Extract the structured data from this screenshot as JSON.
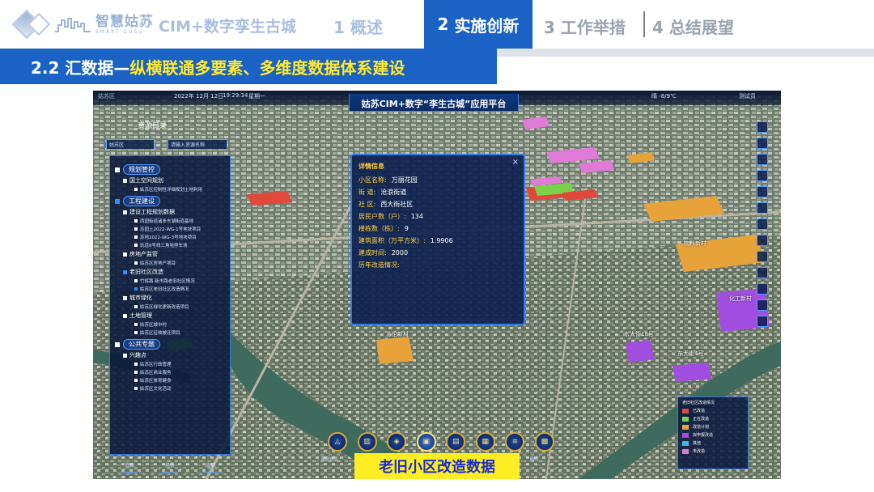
{
  "header": {
    "logo_text": "智慧姑苏",
    "logo_subtext": "SMART GUSU",
    "brand": "CIM+数字孪生古城",
    "nav": [
      {
        "num": "1",
        "label": "概述"
      },
      {
        "num": "2",
        "label": "实施创新"
      },
      {
        "num": "3",
        "label": "工作举措"
      },
      {
        "num": "4",
        "label": "总结展望"
      }
    ]
  },
  "section": {
    "prefix": "2.2 汇数据—",
    "highlight": "纵横联通多要素、多维度数据体系建设"
  },
  "platform": {
    "mini_logo": "姑苏区",
    "date": "2022年 12月 12日",
    "time": "19:29:34",
    "weekday": "星期一",
    "title": "姑苏CIM+数字“李生古城”应用平台",
    "weather": "晴 -8/9℃",
    "user": "测试员",
    "resource_panel": {
      "title": "资源目录",
      "select_value": "姑苏区",
      "search_placeholder": "请输入资源名称",
      "groups": [
        {
          "label": "规划管控",
          "checkbox": "white",
          "children": [
            {
              "label": "国土空间规划",
              "items": [
                "姑苏区控制性详细规划土地利用"
              ]
            }
          ]
        },
        {
          "label": "工程建设",
          "checkbox": "blue",
          "children": [
            {
              "label": "建设工程规划数据",
              "items": [
                "西园街道诸多东湖街道基地",
                "苏园土2022-WG-1号地块项目",
                "苏地2022-WG-3号地块项目",
                "轨道8号线三角咀停车场"
              ]
            },
            {
              "label": "房地产监管",
              "items": [
                "姑苏区房地产项目"
              ]
            },
            {
              "label": "老旧社区改造",
              "items": [
                "竹辉路·新市路老旧社区情况",
                "姑苏区老旧社区改造情况"
              ]
            },
            {
              "label": "城市绿化",
              "items": [
                "姑苏区绿化更新改造项目"
              ]
            },
            {
              "label": "土地管理",
              "items": [
                "姑苏区城中村",
                "姑苏区征收被迁项目"
              ]
            }
          ]
        },
        {
          "label": "公共专题",
          "checkbox": "white",
          "children": [
            {
              "label": "兴趣点",
              "items": [
                "姑苏区行政管理",
                "姑苏区商业服务",
                "姑苏区体育健身",
                "姑苏区文化活动"
              ]
            }
          ]
        }
      ],
      "bottom_tabs": [
        "资源",
        "场景",
        "应用"
      ]
    },
    "detail": {
      "title": "详情信息",
      "close": "×",
      "rows": [
        {
          "k": "小区名称:",
          "v": "万丽花园"
        },
        {
          "k": "街  道:",
          "v": "沧浪街道"
        },
        {
          "k": "社  区:",
          "v": "西大街社区"
        },
        {
          "k": "居民户数（户）:",
          "v": "134"
        },
        {
          "k": "楼栋数（栋）:",
          "v": "9"
        },
        {
          "k": "建筑面积（万平方米）:",
          "v": "1.9906"
        },
        {
          "k": "建成时间:",
          "v": "2000"
        },
        {
          "k": "历年改造情况:",
          "v": ""
        }
      ]
    },
    "map_labels": [
      "苏伦新村",
      "东大街18号",
      "东大街4号",
      "化工新村",
      "物料新村"
    ],
    "legend": {
      "title": "老旧社区改造情况",
      "items": [
        {
          "label": "已改造",
          "color": "#e0483c"
        },
        {
          "label": "正在改造",
          "color": "#7cd14a"
        },
        {
          "label": "改造计划",
          "color": "#e8a23a"
        },
        {
          "label": "拟申报改造",
          "color": "#a24ee0"
        },
        {
          "label": "其他",
          "color": "#3fb6e8"
        },
        {
          "label": "未改造",
          "color": "#e07ad6"
        }
      ]
    },
    "toolbar_labels": [
      "图层管理",
      "图例"
    ],
    "toolbar_icons": [
      "measure-icon",
      "layer-icon",
      "cube-icon",
      "scene-icon",
      "map-icon",
      "book-icon",
      "list-icon",
      "grid-icon"
    ]
  },
  "caption": "老旧小区改造数据"
}
